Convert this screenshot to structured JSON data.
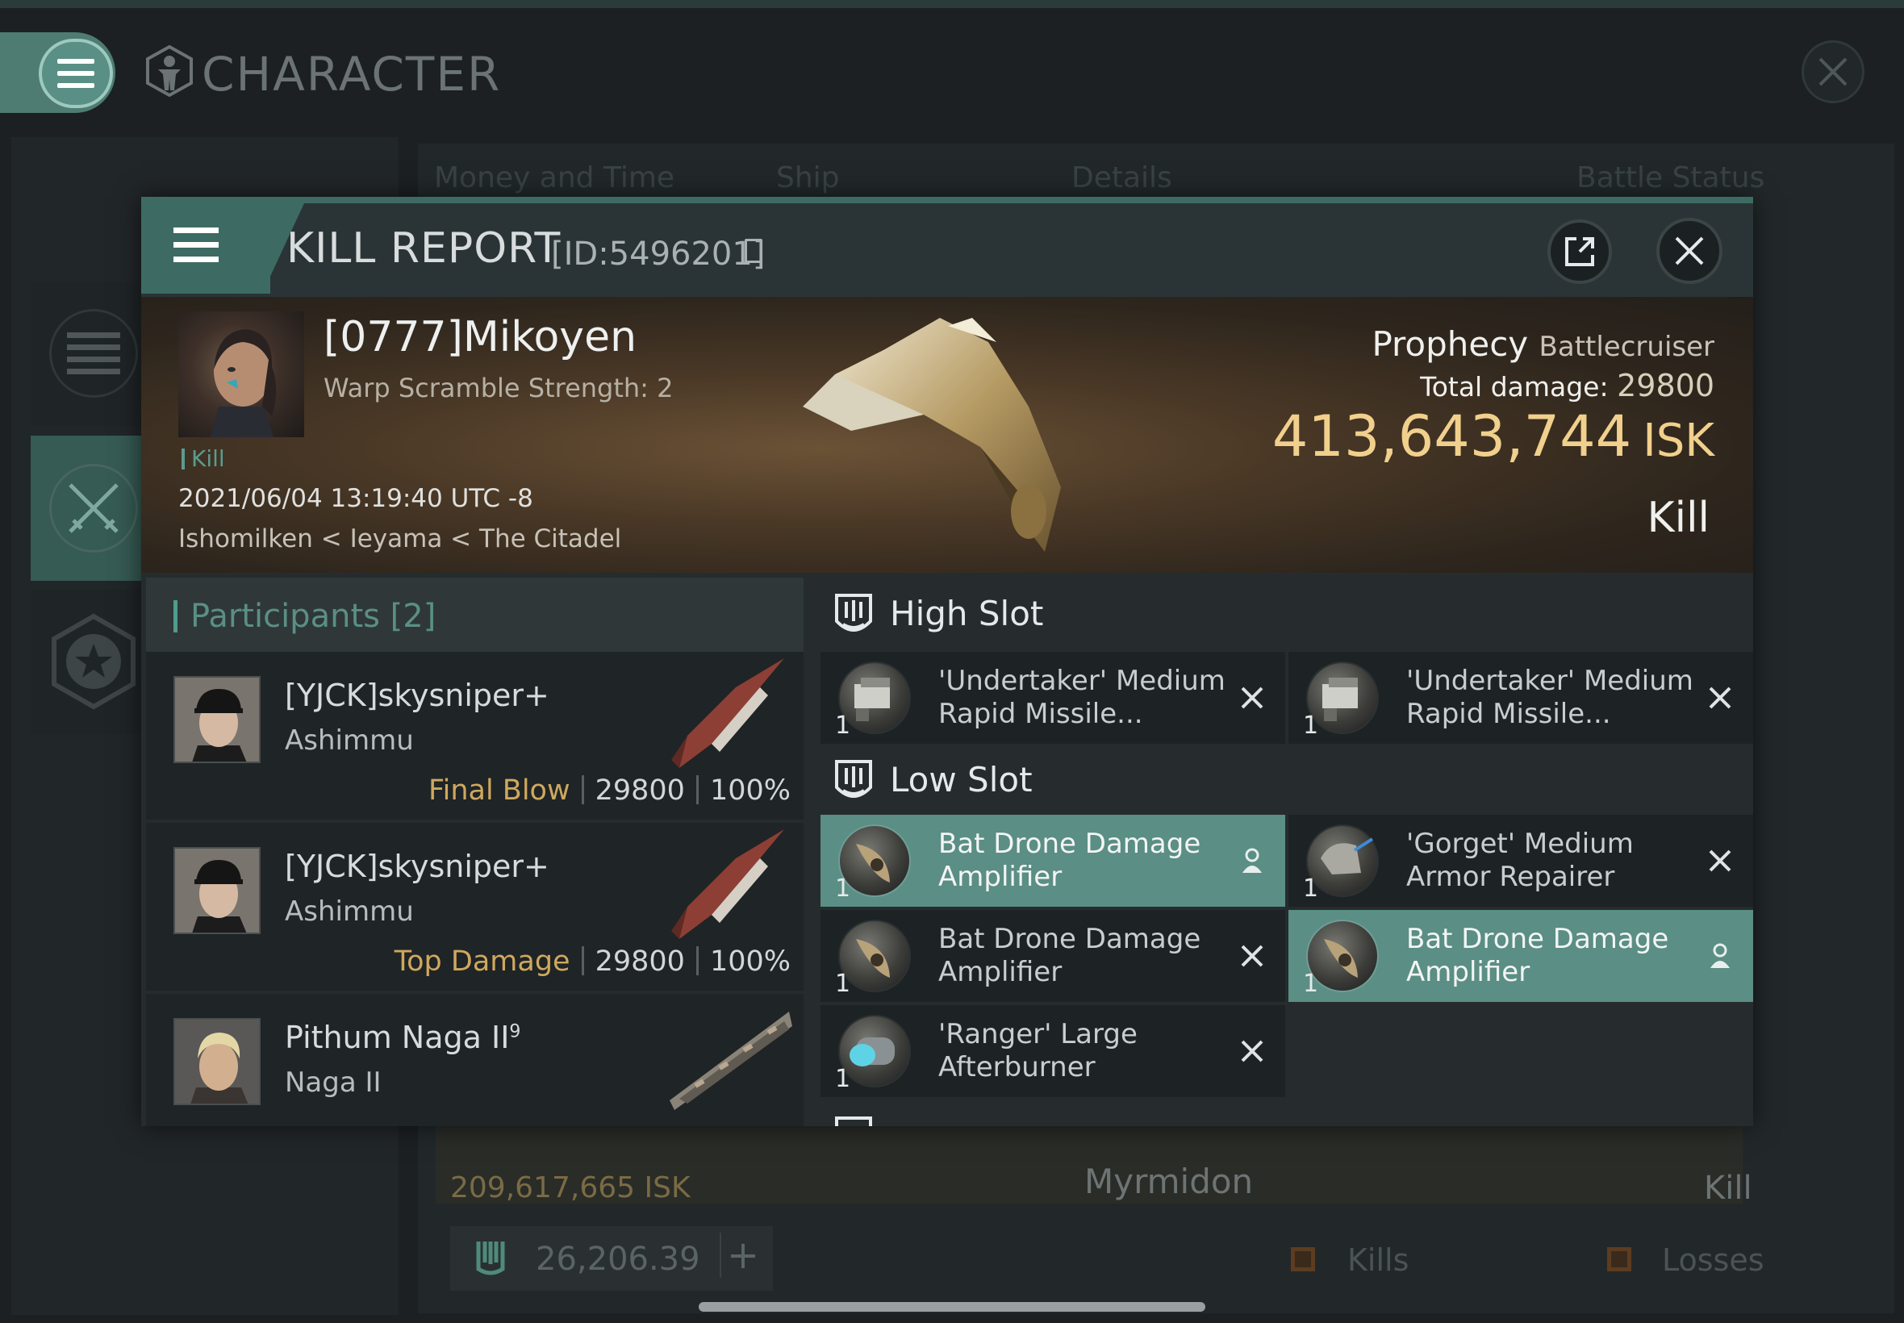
{
  "window": {
    "title": "CHARACTER"
  },
  "background": {
    "columns": [
      "Money and Time",
      "Ship",
      "Details",
      "Battle Status"
    ],
    "row_isk": "209,617,665 ISK",
    "row_ship": "Myrmidon",
    "row_result": "Kill",
    "skill_points": "26,206.39",
    "legend_kills": "Kills",
    "legend_losses": "Losses"
  },
  "kill_report": {
    "title": "KILL REPORT",
    "id": "[ID:5496201]",
    "victim": {
      "name": "[0777]Mikoyen",
      "warp_scramble": "Warp Scramble Strength: 2",
      "tag": "Kill",
      "datetime": "2021/06/04 13:19:40 UTC -8",
      "location": "Ishomilken < Ieyama < The Citadel"
    },
    "ship": {
      "name": "Prophecy",
      "class": "Battlecruiser",
      "total_damage_label": "Total damage:",
      "total_damage": "29800",
      "isk_value": "413,643,744",
      "isk_unit": "ISK",
      "result": "Kill"
    },
    "participants": {
      "title": "Participants [2]",
      "rows": [
        {
          "name": "[YJCK]skysniper+",
          "ship": "Ashimmu",
          "tag": "Final Blow",
          "damage": "29800",
          "percent": "100%"
        },
        {
          "name": "[YJCK]skysniper+",
          "ship": "Ashimmu",
          "tag": "Top Damage",
          "damage": "29800",
          "percent": "100%"
        },
        {
          "name": "Pithum Naga II",
          "name_sup": "9",
          "ship": "Naga II"
        }
      ]
    },
    "fitting": {
      "high_slot_title": "High Slot",
      "low_slot_title": "Low Slot",
      "high": [
        {
          "qty": "1",
          "name": "'Undertaker' Medium Rapid Missile...",
          "state": "destroyed",
          "icon": "missile-launcher-icon"
        },
        {
          "qty": "1",
          "name": "'Undertaker' Medium Rapid Missile...",
          "state": "destroyed",
          "icon": "missile-launcher-icon"
        }
      ],
      "low": [
        {
          "qty": "1",
          "name": "Bat Drone Damage Amplifier",
          "state": "dropped",
          "icon": "drone-amplifier-icon"
        },
        {
          "qty": "1",
          "name": "'Gorget' Medium Armor Repairer",
          "state": "destroyed",
          "icon": "armor-repairer-icon"
        },
        {
          "qty": "1",
          "name": "Bat Drone Damage Amplifier",
          "state": "destroyed",
          "icon": "drone-amplifier-icon"
        },
        {
          "qty": "1",
          "name": "Bat Drone Damage Amplifier",
          "state": "dropped",
          "icon": "drone-amplifier-icon"
        },
        {
          "qty": "1",
          "name": "'Ranger' Large Afterburner",
          "state": "destroyed",
          "icon": "afterburner-icon"
        }
      ]
    }
  },
  "colors": {
    "accent": "#4e7c73",
    "isk_gold": "#f1d08d",
    "final_blow": "#cfa85e",
    "dropped_row": "#5b8e85"
  }
}
